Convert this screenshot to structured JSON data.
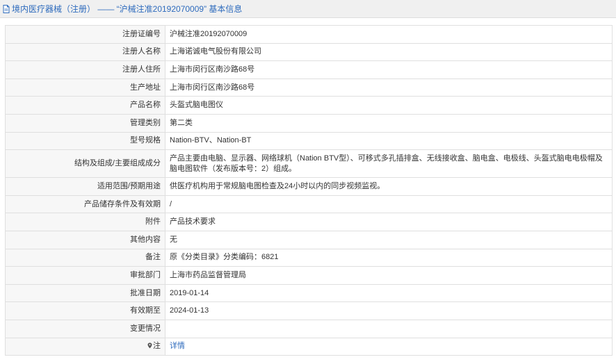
{
  "header": {
    "title": "境内医疗器械（注册） —— “沪械注准20192070009” 基本信息",
    "icon": "document-icon"
  },
  "rows": [
    {
      "label": "注册证编号",
      "value": "沪械注准20192070009"
    },
    {
      "label": "注册人名称",
      "value": "上海诺诚电气股份有限公司"
    },
    {
      "label": "注册人住所",
      "value": "上海市闵行区南沙路68号"
    },
    {
      "label": "生产地址",
      "value": "上海市闵行区南沙路68号"
    },
    {
      "label": "产品名称",
      "value": "头盔式脑电图仪"
    },
    {
      "label": "管理类别",
      "value": "第二类"
    },
    {
      "label": "型号规格",
      "value": "Nation-BTV、Nation-BT"
    },
    {
      "label": "结构及组成/主要组成成分",
      "value": "产品主要由电脑、显示器、网络球机（Nation BTV型）、可移式多孔插排盒、无线接收盒、脑电盒、电极线、头盔式脑电电极帽及脑电图软件（发布版本号：2）组成。"
    },
    {
      "label": "适用范围/预期用途",
      "value": "供医疗机构用于常规脑电图检查及24小时以内的同步视频监视。"
    },
    {
      "label": "产品储存条件及有效期",
      "value": "/"
    },
    {
      "label": "附件",
      "value": "产品技术要求"
    },
    {
      "label": "其他内容",
      "value": "无"
    },
    {
      "label": "备注",
      "value": "原《分类目录》分类编码：6821"
    },
    {
      "label": "审批部门",
      "value": "上海市药品监督管理局"
    },
    {
      "label": "批准日期",
      "value": "2019-01-14"
    },
    {
      "label": "有效期至",
      "value": "2024-01-13"
    },
    {
      "label": "变更情况",
      "value": ""
    }
  ],
  "note_row": {
    "label": "注",
    "icon": "pin-icon",
    "link_text": "详情"
  },
  "colors": {
    "link": "#2e6bbd",
    "label_bg": "#f7f7f7",
    "border": "#dfdfdf"
  }
}
